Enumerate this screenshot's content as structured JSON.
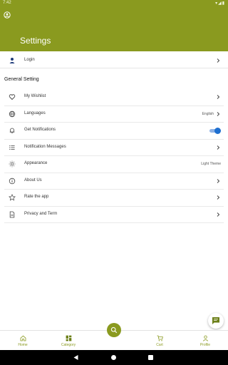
{
  "status": {
    "time": "7:42",
    "icons": "▾◢▮"
  },
  "header": {
    "title": "Settings"
  },
  "login": {
    "label": "Login"
  },
  "section_title": "General Setting",
  "items": [
    {
      "label": "My Wishlist",
      "icon": "heart-icon",
      "value": ""
    },
    {
      "label": "Languages",
      "icon": "globe-icon",
      "value": "English"
    },
    {
      "label": "Get Notifications",
      "icon": "bell-icon",
      "value": "",
      "toggle_on": true
    },
    {
      "label": "Notification Messages",
      "icon": "list-icon",
      "value": ""
    },
    {
      "label": "Appearance",
      "icon": "sun-icon",
      "value": "Light Theme"
    },
    {
      "label": "About Us",
      "icon": "info-icon",
      "value": ""
    },
    {
      "label": "Rate the app",
      "icon": "star-icon",
      "value": ""
    },
    {
      "label": "Privacy and Term",
      "icon": "document-icon",
      "value": ""
    }
  ],
  "bottom_nav": {
    "home": "Home",
    "category": "Category",
    "cart": "Cart",
    "profile": "Profile"
  },
  "colors": {
    "brand": "#8a9a1f",
    "toggle": "#1e6fd0"
  }
}
